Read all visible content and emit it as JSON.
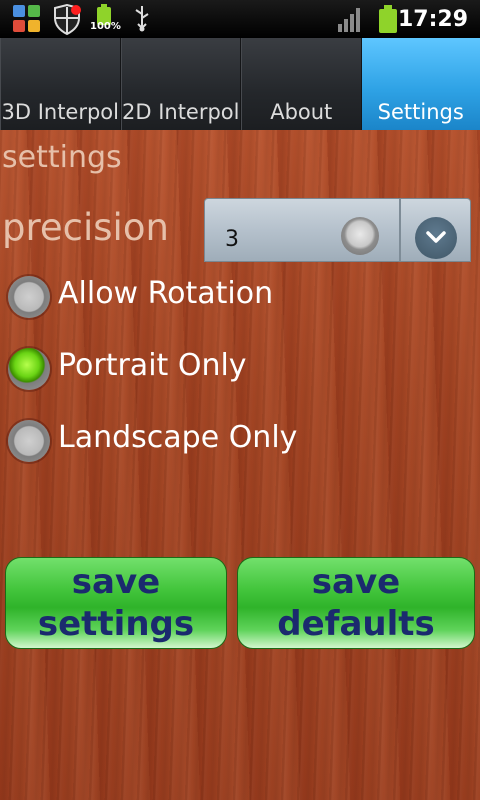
{
  "status_bar": {
    "battery_percent_label": "100%",
    "time": "17:29",
    "icons": [
      "app-grid-icon",
      "shield-notification-icon",
      "battery-full-icon",
      "usb-icon",
      "signal-icon",
      "battery-icon"
    ],
    "colors": {
      "battery_green": "#8fd32a",
      "notification_red": "#ff2020"
    }
  },
  "tabs": [
    {
      "label": "3D Interpol",
      "active": false
    },
    {
      "label": "2D Interpol",
      "active": false
    },
    {
      "label": "About",
      "active": false
    },
    {
      "label": "Settings",
      "active": true
    }
  ],
  "settings": {
    "title": "settings",
    "precision": {
      "label": "precision",
      "value": "3"
    },
    "orientation_options": [
      {
        "label": "Allow Rotation",
        "checked": false
      },
      {
        "label": "Portrait Only",
        "checked": true
      },
      {
        "label": "Landscape Only",
        "checked": false
      }
    ]
  },
  "buttons": {
    "save_settings": "save settings",
    "save_defaults": "save defaults"
  },
  "colors": {
    "tab_active": "#2fa3e6",
    "button_green": "#43c53c",
    "button_text": "#1b2a6e",
    "wood": "#a44624"
  }
}
